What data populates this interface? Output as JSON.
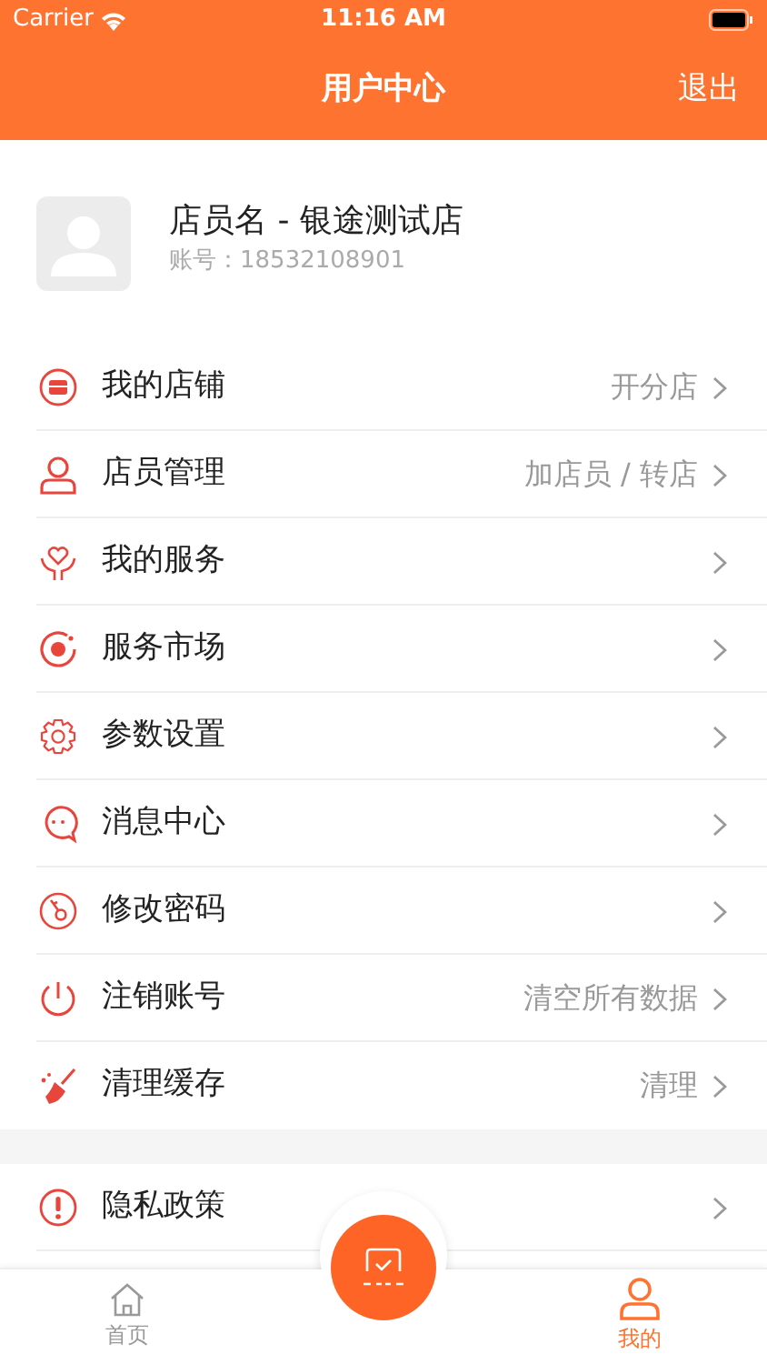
{
  "status_bar": {
    "carrier": "Carrier",
    "time": "11:16 AM"
  },
  "nav_bar": {
    "title": "用户中心",
    "action": "退出"
  },
  "profile": {
    "name": "店员名 - 银途测试店",
    "account": "账号：18532108901"
  },
  "menu": [
    {
      "label": "我的店铺",
      "detail": "开分店"
    },
    {
      "label": "店员管理",
      "detail": "加店员 / 转店"
    },
    {
      "label": "我的服务"
    },
    {
      "label": "服务市场"
    },
    {
      "label": "参数设置"
    },
    {
      "label": "消息中心"
    },
    {
      "label": "修改密码"
    },
    {
      "label": "注销账号",
      "detail": "清空所有数据"
    },
    {
      "label": "清理缓存",
      "detail": "清理"
    }
  ],
  "menu_2": [
    {
      "label": "隐私政策"
    }
  ],
  "tab_bar": [
    {
      "label": "首页",
      "selected": false
    },
    {
      "label": "我的",
      "selected": true
    }
  ]
}
